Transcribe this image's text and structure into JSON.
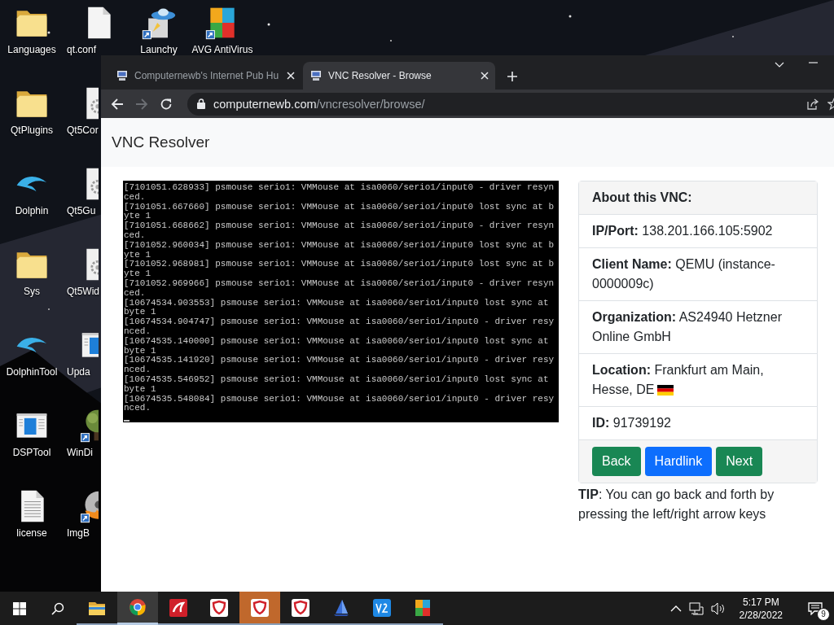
{
  "desktop": {
    "columns": [
      [
        {
          "label": "Languages",
          "kind": "folder",
          "shortcut": false
        },
        {
          "label": "QtPlugins",
          "kind": "folder",
          "shortcut": false
        },
        {
          "label": "Dolphin",
          "kind": "dolphin",
          "shortcut": false
        },
        {
          "label": "Sys",
          "kind": "folder",
          "shortcut": false
        },
        {
          "label": "DolphinTool",
          "kind": "dolphin",
          "shortcut": false
        },
        {
          "label": "DSPTool",
          "kind": "window",
          "shortcut": false
        },
        {
          "label": "license",
          "kind": "text",
          "shortcut": false
        }
      ],
      [
        {
          "label": "qt.conf",
          "kind": "file",
          "shortcut": false
        },
        {
          "label": "Qt5Cor",
          "kind": "gear",
          "shortcut": false
        },
        {
          "label": "Qt5Gu",
          "kind": "gear",
          "shortcut": false
        },
        {
          "label": "Qt5Wid",
          "kind": "gear",
          "shortcut": false
        },
        {
          "label": "Upda",
          "kind": "window",
          "shortcut": false
        },
        {
          "label": "WinDi",
          "kind": "tree",
          "shortcut": true
        },
        {
          "label": "ImgB",
          "kind": "disc",
          "shortcut": true
        }
      ],
      [
        {
          "label": "Launchy",
          "kind": "ufo",
          "shortcut": true
        }
      ],
      [
        {
          "label": "AVG AntiVirus",
          "kind": "tiles",
          "shortcut": true
        }
      ]
    ]
  },
  "browser": {
    "tabs": [
      {
        "title": "Computernewb's Internet Pub Hu",
        "selected": false
      },
      {
        "title": "VNC Resolver - Browse",
        "selected": true
      }
    ],
    "address": {
      "domain": "computernewb.com",
      "path": "/vncresolver/browse/"
    }
  },
  "page": {
    "brand": "VNC Resolver",
    "terminal_lines": [
      "[7101051.628933] psmouse serio1: VMMouse at isa0060/serio1/input0 - driver resyn",
      "ced.",
      "[7101051.667660] psmouse serio1: VMMouse at isa0060/serio1/input0 lost sync at b",
      "yte 1",
      "[7101051.668662] psmouse serio1: VMMouse at isa0060/serio1/input0 - driver resyn",
      "ced.",
      "[7101052.960034] psmouse serio1: VMMouse at isa0060/serio1/input0 lost sync at b",
      "yte 1",
      "[7101052.968981] psmouse serio1: VMMouse at isa0060/serio1/input0 lost sync at b",
      "yte 1",
      "[7101052.969966] psmouse serio1: VMMouse at isa0060/serio1/input0 - driver resyn",
      "ced.",
      "[10674534.903553] psmouse serio1: VMMouse at isa0060/serio1/input0 lost sync at",
      "byte 1",
      "[10674534.904747] psmouse serio1: VMMouse at isa0060/serio1/input0 - driver resy",
      "nced.",
      "[10674535.140000] psmouse serio1: VMMouse at isa0060/serio1/input0 lost sync at",
      "byte 1",
      "[10674535.141920] psmouse serio1: VMMouse at isa0060/serio1/input0 - driver resy",
      "nced.",
      "[10674535.546952] psmouse serio1: VMMouse at isa0060/serio1/input0 lost sync at",
      "byte 1",
      "[10674535.548084] psmouse serio1: VMMouse at isa0060/serio1/input0 - driver resy",
      "nced."
    ],
    "info": {
      "heading": "About this VNC:",
      "rows": [
        {
          "text": "**IP/Port:** 138.201.166.105:5902",
          "flag": false
        },
        {
          "text": "**Client Name:** QEMU (instance-0000009c)",
          "flag": false
        },
        {
          "text": "**Organization:** AS24940 Hetzner Online GmbH",
          "flag": false
        },
        {
          "text": "**Location:** Frankfurt am Main, Hesse, DE",
          "flag": true
        },
        {
          "text": "**ID:** 91739192",
          "flag": false
        }
      ],
      "buttons": [
        {
          "label": "Back",
          "color": "#198754"
        },
        {
          "label": "Hardlink",
          "color": "#0d6efd"
        },
        {
          "label": "Next",
          "color": "#198754"
        }
      ]
    },
    "tip": "**TIP**: You can go back and forth by pressing the left/right arrow keys"
  },
  "taskbar": {
    "apps": [
      {
        "kind": "folder",
        "selected": false,
        "flashing": false
      },
      {
        "kind": "chrome",
        "selected": true,
        "flashing": false
      },
      {
        "kind": "avira",
        "selected": false,
        "flashing": false
      },
      {
        "kind": "shield",
        "selected": false,
        "flashing": false
      },
      {
        "kind": "shield",
        "selected": false,
        "flashing": true
      },
      {
        "kind": "shield",
        "selected": false,
        "flashing": false
      },
      {
        "kind": "boat",
        "selected": false,
        "flashing": false
      },
      {
        "kind": "vs",
        "selected": false,
        "flashing": false
      },
      {
        "kind": "tiles",
        "selected": false,
        "flashing": false
      }
    ],
    "clock": {
      "time": "5:17 PM",
      "date": "2/28/2022"
    },
    "notifications": "9"
  }
}
